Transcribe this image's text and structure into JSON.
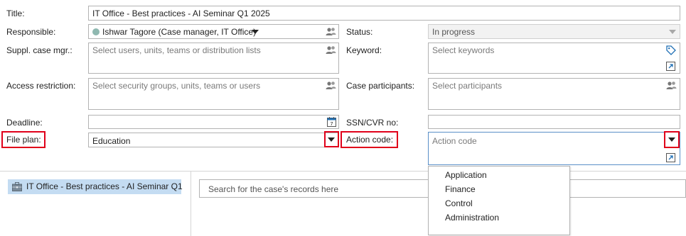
{
  "form": {
    "title": {
      "label": "Title:",
      "value": "IT Office - Best practices - AI Seminar Q1 2025"
    },
    "responsible": {
      "label": "Responsible:",
      "value": "Ishwar Tagore (Case manager, IT Office)"
    },
    "status": {
      "label": "Status:",
      "value": "In progress"
    },
    "suppl_case_mgr": {
      "label": "Suppl. case mgr.:",
      "placeholder": "Select users, units, teams or distribution lists"
    },
    "keyword": {
      "label": "Keyword:",
      "placeholder": "Select keywords"
    },
    "access_restriction": {
      "label": "Access restriction:",
      "placeholder": "Select security groups, units, teams or users"
    },
    "case_participants": {
      "label": "Case participants:",
      "placeholder": "Select participants"
    },
    "deadline": {
      "label": "Deadline:",
      "value": ""
    },
    "ssn_cvr": {
      "label": "SSN/CVR no:",
      "value": ""
    },
    "file_plan": {
      "label": "File plan:",
      "value": "Education"
    },
    "action_code": {
      "label": "Action code:",
      "placeholder": "Action code",
      "options": [
        "Application",
        "Finance",
        "Control",
        "Administration"
      ]
    }
  },
  "tree": {
    "item_label": "IT Office - Best practices - AI Seminar Q1"
  },
  "records": {
    "search_placeholder": "Search for the case's records here"
  },
  "colors": {
    "highlight_red": "#e0001a",
    "tree_selection": "#c4dcf2",
    "status_dot": "#8fb8b0"
  },
  "icons": [
    "user-group-icon",
    "calendar-icon",
    "tag-icon",
    "open-link-icon",
    "case-icon",
    "dropdown-arrow-icon"
  ]
}
